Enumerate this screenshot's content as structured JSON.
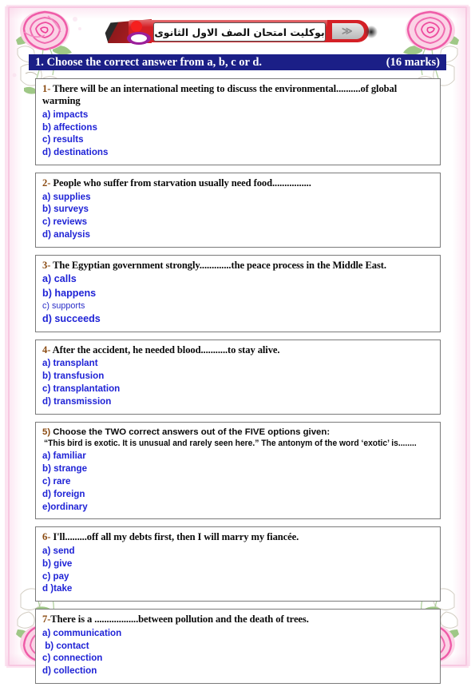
{
  "header": {
    "banner_title": "بوكليت امتحان الصف  الاول الثانوى",
    "chevron": "≫"
  },
  "section": {
    "title": "1. Choose the correct answer from a, b, c or d.",
    "marks": "(16 marks)",
    "bar_color": "#1b1f87"
  },
  "colors": {
    "option_blue": "#1f23d6",
    "banner_red": "#d42026",
    "floral_pink": "#f06bb0"
  },
  "questions": [
    {
      "stem_num": "1-",
      "stem": " There will be an international meeting to discuss the environmental..........of global warming",
      "style": "serif",
      "options": [
        {
          "text": "a) impacts",
          "weight": "normal"
        },
        {
          "text": "b) affections",
          "weight": "normal"
        },
        {
          "text": "c) results",
          "weight": "normal"
        },
        {
          "text": "d) destinations",
          "weight": "normal"
        }
      ]
    },
    {
      "stem_num": "2-",
      "stem": " People who suffer from starvation usually need food................",
      "style": "serif",
      "options": [
        {
          "text": "a) supplies",
          "weight": "normal"
        },
        {
          "text": "b) surveys",
          "weight": "normal"
        },
        {
          "text": "c) reviews",
          "weight": "normal"
        },
        {
          "text": "d) analysis",
          "weight": "normal"
        }
      ]
    },
    {
      "stem_num": "3-",
      "stem": " The Egyptian government strongly.............the peace process in the Middle East.",
      "style": "serif",
      "options": [
        {
          "text": "a) calls",
          "weight": "strong"
        },
        {
          "text": "b) happens",
          "weight": "strong"
        },
        {
          "text": "c) supports",
          "weight": "light"
        },
        {
          "text": "d) succeeds",
          "weight": "strong"
        }
      ]
    },
    {
      "stem_num": "4-",
      "stem": " After the accident, he needed blood...........to stay alive.",
      "style": "serif",
      "options": [
        {
          "text": "a) transplant",
          "weight": "normal"
        },
        {
          "text": "b) transfusion",
          "weight": "normal"
        },
        {
          "text": "c) transplantation",
          "weight": "normal"
        },
        {
          "text": "d) transmission",
          "weight": "normal"
        }
      ]
    },
    {
      "stem_num": "5)",
      "stem": " Choose the TWO correct answers out of the FIVE options given:",
      "stem_line2": "“This bird is exotic. It is unusual and rarely seen here.” The antonym of the word ‘exotic’ is........",
      "style": "sans",
      "options": [
        {
          "text": "a) familiar",
          "weight": "normal"
        },
        {
          "text": "b) strange",
          "weight": "normal"
        },
        {
          "text": "c) rare",
          "weight": "normal"
        },
        {
          "text": "d) foreign",
          "weight": "normal"
        },
        {
          "text": "e)ordinary",
          "weight": "normal"
        }
      ]
    },
    {
      "stem_num": "6-",
      "stem": " I'll.........off all my debts first, then I will marry my fiancée.",
      "style": "serif",
      "options": [
        {
          "text": "a) send",
          "weight": "normal"
        },
        {
          "text": "b) give",
          "weight": "normal"
        },
        {
          "text": "c) pay",
          "weight": "normal"
        },
        {
          "text": "d )take",
          "weight": "normal"
        }
      ]
    },
    {
      "stem_num": "7-",
      "stem": "There is a ..................between pollution and the death of trees.",
      "style": "serif",
      "options": [
        {
          "text": "a) communication",
          "weight": "normal"
        },
        {
          "text": " b) contact",
          "weight": "normal"
        },
        {
          "text": "c) connection",
          "weight": "normal"
        },
        {
          "text": "d) collection",
          "weight": "normal"
        }
      ]
    }
  ]
}
